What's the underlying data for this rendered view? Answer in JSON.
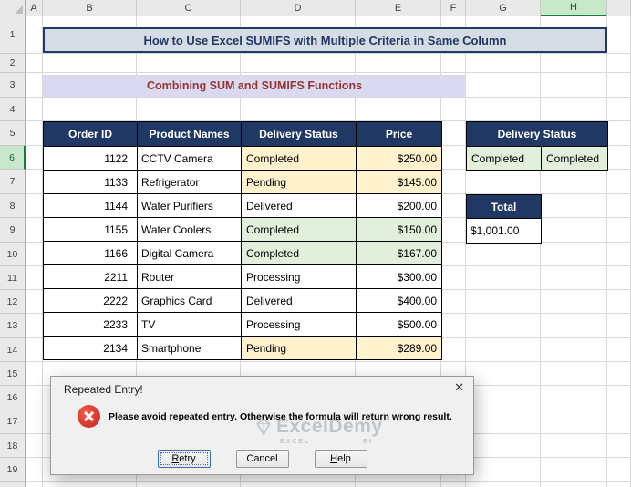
{
  "window": {
    "column_headers": [
      "A",
      "B",
      "C",
      "D",
      "E",
      "F",
      "G",
      "H",
      ""
    ],
    "row_headers": [
      "1",
      "2",
      "3",
      "4",
      "5",
      "6",
      "7",
      "8",
      "9",
      "10",
      "11",
      "12",
      "13",
      "14",
      "15",
      "16",
      "17",
      "18",
      "19"
    ],
    "selected_column": "H",
    "selected_row": "6"
  },
  "titles": {
    "main": "How to Use Excel SUMIFS with Multiple Criteria in Same Column",
    "subtitle": "Combining SUM and SUMIFS Functions"
  },
  "table": {
    "headers": [
      "Order ID",
      "Product Names",
      "Delivery Status",
      "Price"
    ],
    "rows": [
      {
        "order_id": "1122",
        "product": "CCTV Camera",
        "status": "Completed",
        "price": "$250.00",
        "highlight": "yellow"
      },
      {
        "order_id": "1133",
        "product": "Refrigerator",
        "status": "Pending",
        "price": "$145.00",
        "highlight": "yellow"
      },
      {
        "order_id": "1144",
        "product": "Water Purifiers",
        "status": "Delivered",
        "price": "$200.00",
        "highlight": "none"
      },
      {
        "order_id": "1155",
        "product": "Water Coolers",
        "status": "Completed",
        "price": "$150.00",
        "highlight": "green"
      },
      {
        "order_id": "1166",
        "product": "Digital Camera",
        "status": "Completed",
        "price": "$167.00",
        "highlight": "green"
      },
      {
        "order_id": "2211",
        "product": "Router",
        "status": "Processing",
        "price": "$300.00",
        "highlight": "none"
      },
      {
        "order_id": "2222",
        "product": "Graphics Card",
        "status": "Delivered",
        "price": "$400.00",
        "highlight": "none"
      },
      {
        "order_id": "2233",
        "product": "TV",
        "status": "Processing",
        "price": "$500.00",
        "highlight": "none"
      },
      {
        "order_id": "2134",
        "product": "Smartphone",
        "status": "Pending",
        "price": "$289.00",
        "highlight": "yellow"
      }
    ]
  },
  "criteria": {
    "header": "Delivery Status",
    "cell_g6": "Completed",
    "cell_h6": "Completed"
  },
  "total": {
    "header": "Total",
    "value": "$1,001.00"
  },
  "dialog": {
    "title": "Repeated Entry!",
    "close_glyph": "✕",
    "message": "Please avoid repeated entry. Otherwise the formula will return wrong result.",
    "buttons": [
      "Retry",
      "Cancel",
      "Help"
    ]
  },
  "watermark": {
    "brand": "ExcelDemy",
    "sub_left": "EXCEL",
    "sub_right": "BI"
  },
  "colors": {
    "table_header_bg": "#1F3864",
    "title_bg": "#D6DCE4",
    "title_text": "#1F3864",
    "subtitle_bg": "#DAD9F0",
    "subtitle_text": "#943634",
    "yellow_highlight": "#FFF2CC",
    "green_highlight": "#E2EFDA",
    "selected_column_header_bg": "#C9E7CB",
    "selected_cell_border": "#FF0000",
    "error_icon": "#D92B21"
  }
}
